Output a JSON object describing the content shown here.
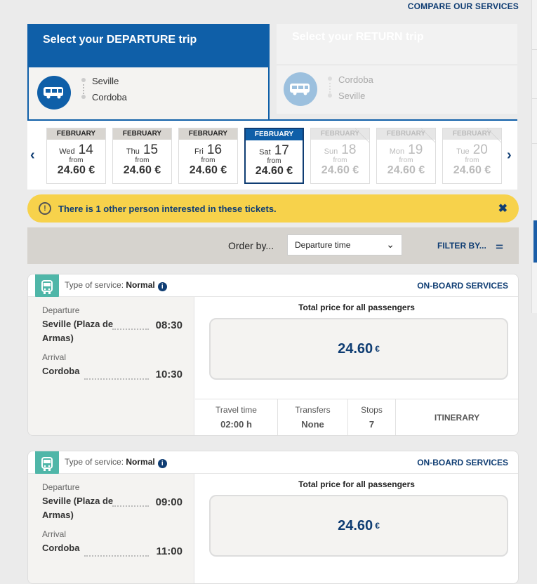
{
  "header": {
    "compare_label": "COMPARE OUR SERVICES"
  },
  "departure_tab": {
    "title": "Select your DEPARTURE trip",
    "from": "Seville",
    "to": "Cordoba",
    "icon": "bus-icon"
  },
  "return_tab": {
    "title": "Select your RETURN trip",
    "from": "Cordoba",
    "to": "Seville",
    "icon": "bus-icon"
  },
  "dates": [
    {
      "month": "FEBRUARY",
      "weekday": "Wed",
      "day": "14",
      "from": "from",
      "price": "24.60 €",
      "state": "normal"
    },
    {
      "month": "FEBRUARY",
      "weekday": "Thu",
      "day": "15",
      "from": "from",
      "price": "24.60 €",
      "state": "normal"
    },
    {
      "month": "FEBRUARY",
      "weekday": "Fri",
      "day": "16",
      "from": "from",
      "price": "24.60 €",
      "state": "normal"
    },
    {
      "month": "FEBRUARY",
      "weekday": "Sat",
      "day": "17",
      "from": "from",
      "price": "24.60 €",
      "state": "selected"
    },
    {
      "month": "FEBRUARY",
      "weekday": "Sun",
      "day": "18",
      "from": "from",
      "price": "24.60 €",
      "state": "disabled"
    },
    {
      "month": "FEBRUARY",
      "weekday": "Mon",
      "day": "19",
      "from": "from",
      "price": "24.60 €",
      "state": "disabled"
    },
    {
      "month": "FEBRUARY",
      "weekday": "Tue",
      "day": "20",
      "from": "from",
      "price": "24.60 €",
      "state": "disabled"
    }
  ],
  "notice": {
    "text": "There is 1 other person interested in these tickets."
  },
  "order": {
    "label": "Order by...",
    "selected": "Departure time",
    "filter_label": "FILTER BY..."
  },
  "trips": [
    {
      "service_label": "Type of service:",
      "service": "Normal",
      "onboard": "ON-BOARD SERVICES",
      "dep_label": "Departure",
      "dep_place": "Seville (Plaza de Armas)",
      "dep_time": "08:30",
      "arr_label": "Arrival",
      "arr_place": "Cordoba",
      "arr_time": "10:30",
      "total_label": "Total price for all passengers",
      "price": "24.60",
      "currency": "€",
      "travel_label": "Travel time",
      "travel": "02:00 h",
      "transfers_label": "Transfers",
      "transfers": "None",
      "stops_label": "Stops",
      "stops": "7",
      "itinerary": "ITINERARY"
    },
    {
      "service_label": "Type of service:",
      "service": "Normal",
      "onboard": "ON-BOARD SERVICES",
      "dep_label": "Departure",
      "dep_place": "Seville (Plaza de Armas)",
      "dep_time": "09:00",
      "arr_label": "Arrival",
      "arr_place": "Cordoba",
      "arr_time": "11:00",
      "total_label": "Total price for all passengers",
      "price": "24.60",
      "currency": "€"
    }
  ],
  "colors": {
    "primary": "#0f5fa8",
    "dark": "#0f3d73",
    "notice": "#f7d24b",
    "bus_badge": "#4fb6a8"
  }
}
